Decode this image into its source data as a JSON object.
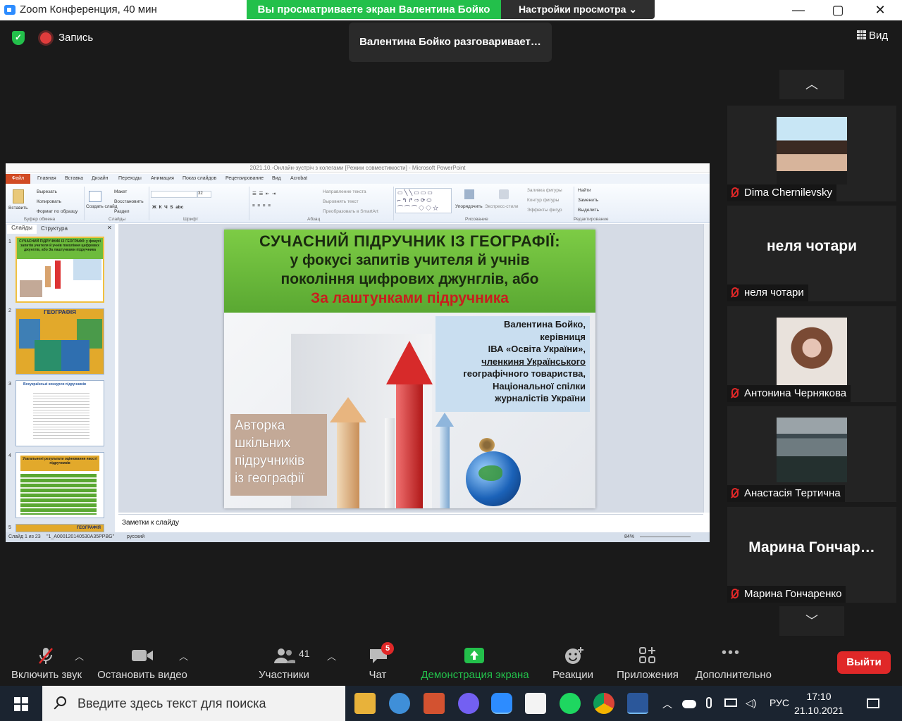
{
  "window": {
    "title": "Zoom Конференция, 40 мин",
    "share_banner": "Вы просматриваете экран Валентина Бойко",
    "view_settings": "Настройки просмотра",
    "minimize": "—",
    "restore": "▢",
    "close": "✕"
  },
  "top": {
    "record_label": "Запись",
    "talking_notice": "Валентина Бойко разговаривает…",
    "view_label": "Вид"
  },
  "ppt": {
    "title": "2021.10.-Онлайн-зустріч з колегами [Режим совместимости] - Microsoft PowerPoint",
    "file_tab": "Файл",
    "tabs": [
      "Главная",
      "Вставка",
      "Дизайн",
      "Переходы",
      "Анимация",
      "Показ слайдов",
      "Рецензирование",
      "Вид",
      "Acrobat"
    ],
    "ribbon": {
      "paste": "Вставить",
      "cut": "Вырезать",
      "copy": "Копировать",
      "format_painter": "Формат по образцу",
      "clipboard_group": "Буфер обмена",
      "new_slide": "Создать слайд",
      "layout": "Макет",
      "reset": "Восстановить",
      "section": "Раздел",
      "slides_group": "Слайды",
      "font_group": "Шрифт",
      "font_size": "32",
      "text_direction": "Направление текста",
      "align_text": "Выровнять текст",
      "smartart": "Преобразовать в SmartArt",
      "paragraph_group": "Абзац",
      "arrange": "Упорядочить",
      "quick_styles": "Экспресс-стили",
      "shape_fill": "Заливка фигуры",
      "shape_outline": "Контур фигуры",
      "shape_effects": "Эффекты фигур",
      "drawing_group": "Рисование",
      "find": "Найти",
      "replace": "Заменить",
      "select": "Выделить",
      "editing_group": "Редактирование"
    },
    "side_tabs": [
      "Слайды",
      "Структура"
    ],
    "thumbs": [
      {
        "num": "1",
        "title": "СУЧАСНИЙ ПІДРУЧНИК ІЗ ГЕОГРАФІЇ: у фокусі запитів учителя й учнів покоління цифрових джунглів, або За лаштунками підручника"
      },
      {
        "num": "2",
        "title": "ГЕОГРАФІЯ"
      },
      {
        "num": "3",
        "title": "Всеукраїнські конкурси підручників"
      },
      {
        "num": "4",
        "title": "Узагальнені результати оцінювання якості підручників"
      },
      {
        "num": "5",
        "title": "ГЕОГРАФІЯ"
      }
    ],
    "notes_label": "Заметки к слайду",
    "status": {
      "slide_of": "Слайд 1 из 23",
      "theme": "\"1_A000120140530A35PPBG\"",
      "language": "русский",
      "zoom": "84%"
    }
  },
  "slide": {
    "line1": "СУЧАСНИЙ  ПІДРУЧНИК  ІЗ  ГЕОГРАФІЇ:",
    "line2": "у фокусі запитів учителя й учнів",
    "line3": "покоління цифрових джунглів, або",
    "line4": "За лаштунками підручника",
    "author_lines": [
      "Валентина Бойко,",
      "керівниця",
      "ІВА «Освіта України»,",
      "членкиня Українського",
      "географічного товариства,",
      "Національної спілки",
      "журналістів України"
    ],
    "tag_lines": [
      "Авторка",
      "шкільних",
      "підручників",
      "із географії"
    ]
  },
  "participants": [
    {
      "name": "Dima Chernilevsky",
      "has_photo": true
    },
    {
      "name": "неля чотари",
      "big_name": "неля чотари",
      "has_photo": false
    },
    {
      "name": "Антонина Чернякова",
      "has_photo": true
    },
    {
      "name": "Анастасія Тертична",
      "has_photo": true
    },
    {
      "name": "Марина Гончаренко",
      "big_name": "Марина  Гончар…",
      "has_photo": false
    }
  ],
  "toolbar": {
    "unmute": "Включить звук",
    "stop_video": "Остановить видео",
    "participants": "Участники",
    "participants_count": "41",
    "chat": "Чат",
    "chat_badge": "5",
    "share_screen": "Демонстрация экрана",
    "reactions": "Реакции",
    "apps": "Приложения",
    "more": "Дополнительно",
    "leave": "Выйти"
  },
  "taskbar": {
    "search_placeholder": "Введите здесь текст для поиска",
    "lang": "РУС",
    "time": "17:10",
    "date": "21.10.2021"
  },
  "colors": {
    "share_green": "#23c04b",
    "leave_red": "#e02828",
    "slide_head_green": "#6dbb3c",
    "slide_red_text": "#c81e1e"
  }
}
